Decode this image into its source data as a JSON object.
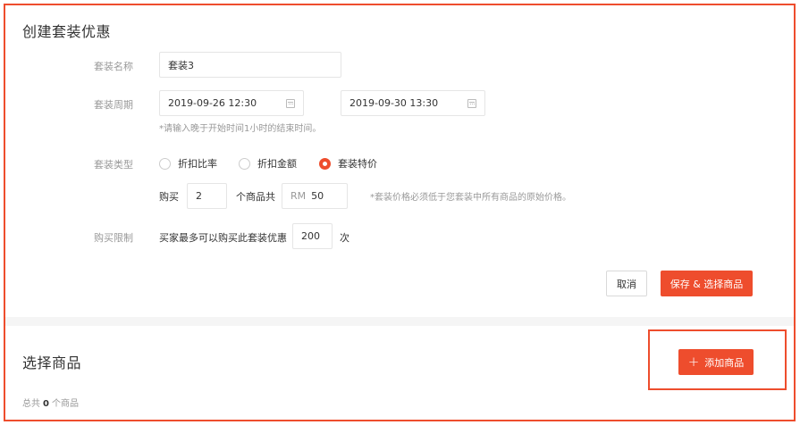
{
  "create_section": {
    "title": "创建套装优惠",
    "name": {
      "label": "套装名称",
      "value": "套装3"
    },
    "period": {
      "label": "套装周期",
      "start": "2019-09-26 12:30",
      "end": "2019-09-30 13:30",
      "hint": "*请输入晚于开始时间1小时的结束时间。"
    },
    "type": {
      "label": "套装类型",
      "options": [
        {
          "label": "折扣比率",
          "checked": false
        },
        {
          "label": "折扣金额",
          "checked": false
        },
        {
          "label": "套装特价",
          "checked": true
        }
      ]
    },
    "buy": {
      "prefix": "购买",
      "quantity": "2",
      "middle": "个商品共",
      "currency": "RM",
      "price": "50",
      "hint": "*套装价格必须低于您套装中所有商品的原始价格。"
    },
    "limit": {
      "label": "购买限制",
      "prefix": "买家最多可以购买此套装优惠",
      "value": "200",
      "suffix": "次"
    },
    "buttons": {
      "cancel": "取消",
      "save": "保存 & 选择商品"
    }
  },
  "products_section": {
    "title": "选择商品",
    "add_button": "添加商品",
    "total_prefix": "总共",
    "total_count": "0",
    "total_suffix": "个商品"
  },
  "colors": {
    "accent": "#ee4d2d",
    "muted_text": "#999999",
    "border": "#e5e5e5"
  },
  "icons": {
    "date": "calendar-icon",
    "add": "plus-icon"
  }
}
